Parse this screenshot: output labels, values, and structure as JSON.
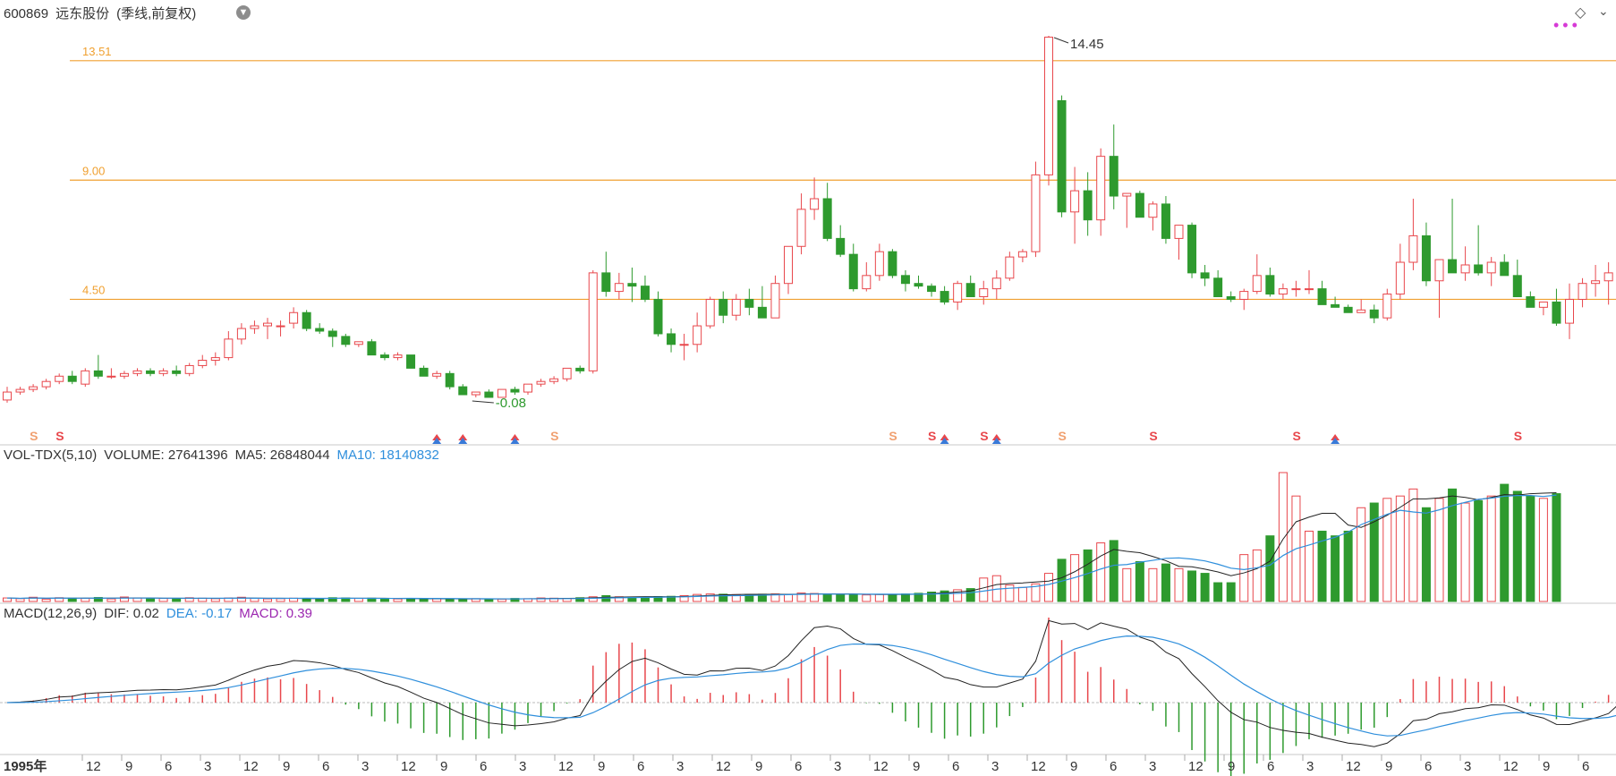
{
  "header": {
    "code": "600869",
    "name": "远东股份",
    "mode": "(季线,前复权)"
  },
  "price_panel": {
    "levels": [
      "13.51",
      "9.00",
      "4.50"
    ],
    "high_label": "14.45",
    "low_label": "-0.08"
  },
  "vol_panel": {
    "name": "VOL-TDX(5,10)",
    "volume": "VOLUME: 27641396",
    "ma5": "MA5: 26848044",
    "ma10": "MA10: 18140832"
  },
  "macd_panel": {
    "name": "MACD(12,26,9)",
    "dif": "DIF: 0.02",
    "dea": "DEA: -0.17",
    "macd": "MACD: 0.39"
  },
  "xaxis": {
    "labels": [
      "1995年",
      "12",
      "9",
      "6",
      "3",
      "12",
      "9",
      "6",
      "3",
      "12",
      "9",
      "6",
      "3",
      "12",
      "9",
      "6",
      "3",
      "12",
      "9",
      "6",
      "3",
      "12",
      "9",
      "6",
      "3",
      "12",
      "9",
      "6",
      "3",
      "12",
      "9",
      "6",
      "3",
      "12",
      "9",
      "6",
      "3",
      "12",
      "9",
      "6"
    ]
  },
  "colors": {
    "up": "#e8474c",
    "down": "#2e9a2e",
    "level": "#f0a030",
    "ma5": "#222222",
    "ma10": "#2f8fdc",
    "macd_title": "#9c27b0"
  },
  "chart_data": {
    "type": "candlestick",
    "period": "quarterly",
    "candles": [
      [
        0.7,
        1.2,
        0.6,
        1.0
      ],
      [
        1.0,
        1.2,
        0.9,
        1.1
      ],
      [
        1.1,
        1.3,
        1.0,
        1.2
      ],
      [
        1.2,
        1.5,
        1.1,
        1.4
      ],
      [
        1.4,
        1.7,
        1.3,
        1.6
      ],
      [
        1.6,
        1.8,
        1.3,
        1.4
      ],
      [
        1.3,
        1.9,
        1.2,
        1.8
      ],
      [
        1.8,
        2.4,
        1.5,
        1.6
      ],
      [
        1.6,
        1.9,
        1.5,
        1.6
      ],
      [
        1.6,
        1.8,
        1.5,
        1.7
      ],
      [
        1.7,
        1.9,
        1.6,
        1.8
      ],
      [
        1.8,
        1.9,
        1.6,
        1.7
      ],
      [
        1.7,
        1.9,
        1.6,
        1.8
      ],
      [
        1.8,
        2.0,
        1.6,
        1.7
      ],
      [
        1.7,
        2.1,
        1.6,
        2.0
      ],
      [
        2.0,
        2.4,
        1.9,
        2.2
      ],
      [
        2.2,
        2.5,
        2.0,
        2.3
      ],
      [
        2.3,
        3.3,
        2.2,
        3.0
      ],
      [
        3.0,
        3.6,
        2.8,
        3.4
      ],
      [
        3.4,
        3.7,
        3.2,
        3.5
      ],
      [
        3.5,
        3.8,
        3.0,
        3.6
      ],
      [
        3.5,
        3.7,
        3.1,
        3.5
      ],
      [
        3.6,
        4.2,
        3.4,
        4.0
      ],
      [
        4.0,
        4.1,
        3.3,
        3.4
      ],
      [
        3.4,
        3.6,
        3.2,
        3.3
      ],
      [
        3.3,
        3.4,
        2.7,
        3.1
      ],
      [
        3.1,
        3.2,
        2.7,
        2.8
      ],
      [
        2.8,
        2.9,
        2.7,
        2.9
      ],
      [
        2.9,
        3.0,
        2.4,
        2.4
      ],
      [
        2.4,
        2.5,
        2.2,
        2.3
      ],
      [
        2.3,
        2.5,
        2.2,
        2.4
      ],
      [
        2.4,
        2.4,
        1.9,
        1.9
      ],
      [
        1.9,
        2.0,
        1.6,
        1.6
      ],
      [
        1.6,
        1.8,
        1.5,
        1.7
      ],
      [
        1.7,
        1.8,
        1.1,
        1.2
      ],
      [
        1.2,
        1.3,
        0.9,
        0.9
      ],
      [
        0.9,
        1.0,
        0.8,
        1.0
      ],
      [
        1.0,
        1.1,
        0.8,
        0.8
      ],
      [
        0.8,
        0.9,
        0.9,
        1.1
      ],
      [
        1.1,
        1.2,
        0.9,
        1.0
      ],
      [
        1.0,
        1.3,
        0.9,
        1.3
      ],
      [
        1.3,
        1.5,
        1.2,
        1.4
      ],
      [
        1.4,
        1.6,
        1.3,
        1.5
      ],
      [
        1.5,
        1.9,
        1.4,
        1.9
      ],
      [
        1.9,
        2.0,
        1.7,
        1.8
      ],
      [
        1.8,
        5.6,
        1.7,
        5.5
      ],
      [
        5.5,
        6.3,
        4.6,
        4.8
      ],
      [
        4.8,
        5.5,
        4.5,
        5.1
      ],
      [
        5.1,
        5.7,
        4.4,
        5.0
      ],
      [
        5.0,
        5.4,
        4.4,
        4.5
      ],
      [
        4.5,
        4.8,
        3.1,
        3.2
      ],
      [
        3.2,
        3.4,
        2.5,
        2.8
      ],
      [
        2.8,
        3.2,
        2.2,
        2.8
      ],
      [
        2.8,
        4.0,
        2.5,
        3.5
      ],
      [
        3.5,
        4.6,
        3.4,
        4.5
      ],
      [
        4.5,
        4.8,
        3.6,
        3.9
      ],
      [
        3.9,
        4.7,
        3.7,
        4.5
      ],
      [
        4.5,
        4.9,
        3.9,
        4.2
      ],
      [
        4.2,
        5.0,
        3.8,
        3.8
      ],
      [
        3.8,
        5.4,
        3.8,
        5.1
      ],
      [
        5.1,
        6.5,
        4.7,
        6.5
      ],
      [
        6.5,
        8.5,
        6.2,
        7.9
      ],
      [
        7.9,
        9.1,
        7.5,
        8.3
      ],
      [
        8.3,
        8.9,
        6.7,
        6.8
      ],
      [
        6.8,
        7.3,
        6.1,
        6.2
      ],
      [
        6.2,
        6.6,
        4.8,
        4.9
      ],
      [
        4.9,
        5.9,
        4.8,
        5.4
      ],
      [
        5.4,
        6.6,
        5.2,
        6.3
      ],
      [
        6.3,
        6.4,
        5.3,
        5.4
      ],
      [
        5.4,
        5.6,
        4.8,
        5.1
      ],
      [
        5.1,
        5.4,
        4.9,
        5.0
      ],
      [
        5.0,
        5.1,
        4.6,
        4.8
      ],
      [
        4.8,
        5.0,
        4.3,
        4.4
      ],
      [
        4.4,
        5.2,
        4.1,
        5.1
      ],
      [
        5.1,
        5.4,
        4.6,
        4.6
      ],
      [
        4.6,
        5.2,
        4.3,
        4.9
      ],
      [
        4.9,
        5.6,
        4.5,
        5.3
      ],
      [
        5.3,
        6.3,
        5.2,
        6.1
      ],
      [
        6.1,
        6.4,
        5.9,
        6.3
      ],
      [
        6.3,
        9.7,
        6.1,
        9.2
      ],
      [
        9.2,
        14.45,
        8.8,
        14.4
      ],
      [
        12.0,
        12.2,
        7.6,
        7.8
      ],
      [
        7.8,
        9.5,
        6.6,
        8.6
      ],
      [
        8.6,
        9.3,
        6.9,
        7.5
      ],
      [
        7.5,
        10.2,
        6.9,
        9.9
      ],
      [
        9.9,
        11.1,
        7.9,
        8.4
      ],
      [
        8.4,
        8.5,
        7.2,
        8.5
      ],
      [
        8.5,
        8.6,
        7.6,
        7.6
      ],
      [
        7.6,
        8.2,
        7.1,
        8.1
      ],
      [
        8.1,
        8.4,
        6.6,
        6.8
      ],
      [
        6.8,
        7.3,
        6.0,
        7.3
      ],
      [
        7.3,
        7.4,
        5.3,
        5.5
      ],
      [
        5.5,
        5.8,
        5.0,
        5.3
      ],
      [
        5.3,
        5.6,
        4.6,
        4.6
      ],
      [
        4.6,
        4.8,
        4.4,
        4.5
      ],
      [
        4.5,
        4.9,
        4.1,
        4.8
      ],
      [
        4.8,
        6.2,
        4.7,
        5.4
      ],
      [
        5.4,
        5.7,
        4.6,
        4.7
      ],
      [
        4.7,
        5.1,
        4.5,
        4.9
      ],
      [
        4.9,
        5.2,
        4.6,
        4.9
      ],
      [
        4.9,
        5.6,
        4.7,
        4.9
      ],
      [
        4.9,
        5.2,
        4.3,
        4.3
      ],
      [
        4.3,
        4.6,
        4.2,
        4.2
      ],
      [
        4.2,
        4.3,
        4.0,
        4.0
      ],
      [
        4.0,
        4.5,
        4.0,
        4.1
      ],
      [
        4.1,
        4.3,
        3.6,
        3.8
      ],
      [
        3.8,
        4.9,
        3.7,
        4.7
      ],
      [
        4.7,
        6.6,
        4.5,
        5.9
      ],
      [
        5.9,
        8.3,
        5.6,
        6.9
      ],
      [
        6.9,
        7.4,
        5.0,
        5.2
      ],
      [
        5.2,
        6.0,
        3.8,
        6.0
      ],
      [
        6.0,
        8.3,
        5.7,
        5.5
      ],
      [
        5.5,
        6.5,
        5.2,
        5.8
      ],
      [
        5.8,
        7.3,
        5.4,
        5.5
      ],
      [
        5.5,
        6.1,
        5.0,
        5.9
      ],
      [
        5.9,
        6.2,
        5.4,
        5.4
      ],
      [
        5.4,
        6.0,
        4.6,
        4.6
      ],
      [
        4.6,
        4.8,
        4.2,
        4.2
      ],
      [
        4.2,
        4.4,
        3.9,
        4.4
      ],
      [
        4.4,
        4.9,
        3.5,
        3.6
      ],
      [
        3.6,
        5.1,
        3.0,
        4.5
      ],
      [
        4.5,
        5.3,
        4.2,
        5.1
      ],
      [
        5.1,
        5.8,
        4.6,
        5.2
      ],
      [
        5.2,
        5.9,
        4.3,
        5.5
      ],
      [
        5.5,
        7.6,
        5.3,
        7.1
      ]
    ],
    "volume": [
      1.5,
      1.2,
      1.8,
      1.0,
      1.6,
      1.4,
      1.3,
      1.7,
      1.1,
      1.9,
      1.5,
      1.2,
      1.3,
      1.1,
      1.6,
      1.4,
      1.2,
      1.5,
      1.8,
      1.3,
      1.1,
      1.2,
      1.4,
      1.3,
      1.2,
      1.6,
      1.5,
      1.3,
      1.4,
      1.2,
      1.1,
      1.3,
      1.0,
      1.2,
      1.1,
      1.0,
      1.2,
      1.1,
      1.0,
      1.3,
      1.2,
      1.5,
      1.4,
      1.3,
      1.6,
      2.0,
      2.5,
      2.0,
      1.8,
      1.9,
      2.1,
      2.2,
      2.5,
      3.0,
      3.2,
      3.1,
      2.9,
      3.0,
      3.1,
      3.2,
      3.0,
      3.6,
      3.4,
      3.0,
      2.9,
      3.1,
      2.8,
      3.0,
      2.9,
      3.2,
      3.5,
      4.0,
      4.5,
      5.0,
      5.5,
      10.0,
      11.0,
      7.0,
      6.0,
      7.5,
      12.0,
      18.0,
      20.0,
      22.0,
      25.0,
      26.0,
      14.0,
      17.0,
      14.0,
      16.0,
      14.0,
      13.0,
      12.0,
      8.0,
      8.0,
      20.0,
      22.0,
      28.0,
      55.0,
      45.0,
      30.0,
      30.0,
      28.0,
      30.0,
      40.0,
      42.0,
      44.0,
      45.0,
      48.0,
      40.0,
      44.0,
      48.0,
      42.0,
      43.0,
      45.0,
      50.0,
      47.0,
      45.0,
      44.0,
      46.0
    ],
    "vol_indicators": {
      "VOLUME": 27641396,
      "MA5": 26848044,
      "MA10": 18140832
    },
    "macd_indicators": {
      "DIF": 0.02,
      "DEA": -0.17,
      "MACD": 0.39
    },
    "price_levels": [
      13.51,
      9.0,
      4.5
    ],
    "high": 14.45,
    "low": -0.08
  }
}
